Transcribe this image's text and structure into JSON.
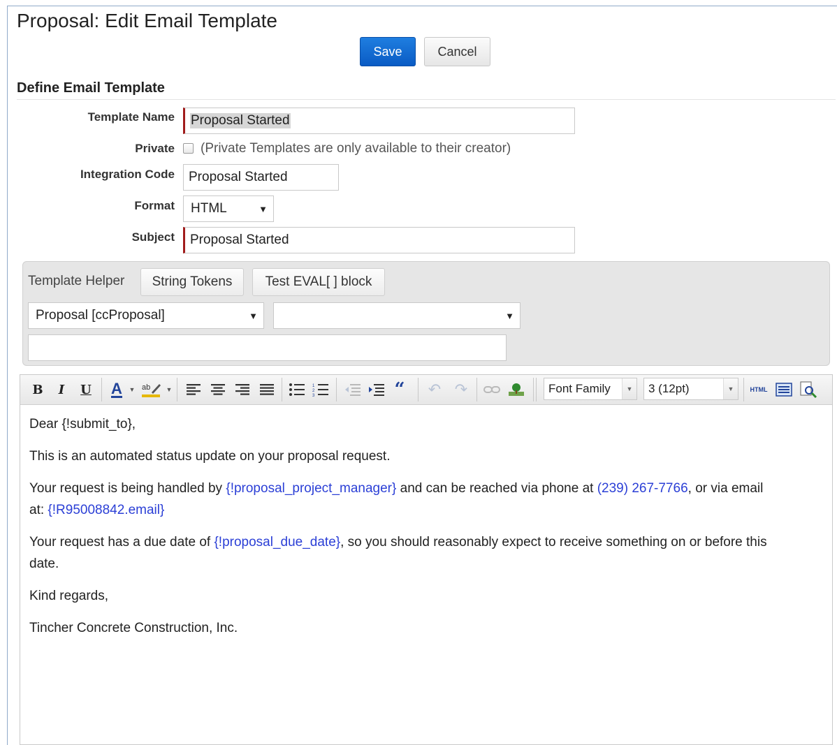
{
  "page": {
    "title": "Proposal: Edit Email Template"
  },
  "actions": {
    "save_label": "Save",
    "cancel_label": "Cancel"
  },
  "section": {
    "title": "Define Email Template"
  },
  "form": {
    "template_name": {
      "label": "Template Name",
      "value": "Proposal Started"
    },
    "private": {
      "label": "Private",
      "checked": false,
      "note": "(Private Templates are only available to their creator)"
    },
    "integration_code": {
      "label": "Integration Code",
      "value": "Proposal Started"
    },
    "format": {
      "label": "Format",
      "value": "HTML"
    },
    "subject": {
      "label": "Subject",
      "value": "Proposal Started"
    }
  },
  "template_helper": {
    "label": "Template Helper",
    "string_tokens_label": "String Tokens",
    "test_eval_label": "Test EVAL[ ] block",
    "object_select_value": "Proposal [ccProposal]",
    "field_select_value": "",
    "token_output_value": ""
  },
  "toolbar": {
    "bold": "B",
    "italic": "I",
    "underline": "U",
    "font_color": "A",
    "font_family_value": "Font Family",
    "font_size_value": "3 (12pt)",
    "html_label": "HTML"
  },
  "editor_body": {
    "line1": "Dear {!submit_to},",
    "line2": "This is an automated status update on your proposal request.",
    "line3_a": "Your request is being handled by ",
    "line3_token1": "{!proposal_project_manager}",
    "line3_b": " and can be reached via phone at ",
    "line3_phone": "(239) 267-7766",
    "line3_c": ", or via email",
    "line4_a": "at: ",
    "line4_token": "{!R95008842.email}",
    "line5_a": "Your request has a due date of ",
    "line5_token": "{!proposal_due_date}",
    "line5_b": ", so you should reasonably expect to receive something on or before this",
    "line6": "date.",
    "line7": "Kind regards,",
    "line8": "Tincher Concrete Construction, Inc."
  }
}
